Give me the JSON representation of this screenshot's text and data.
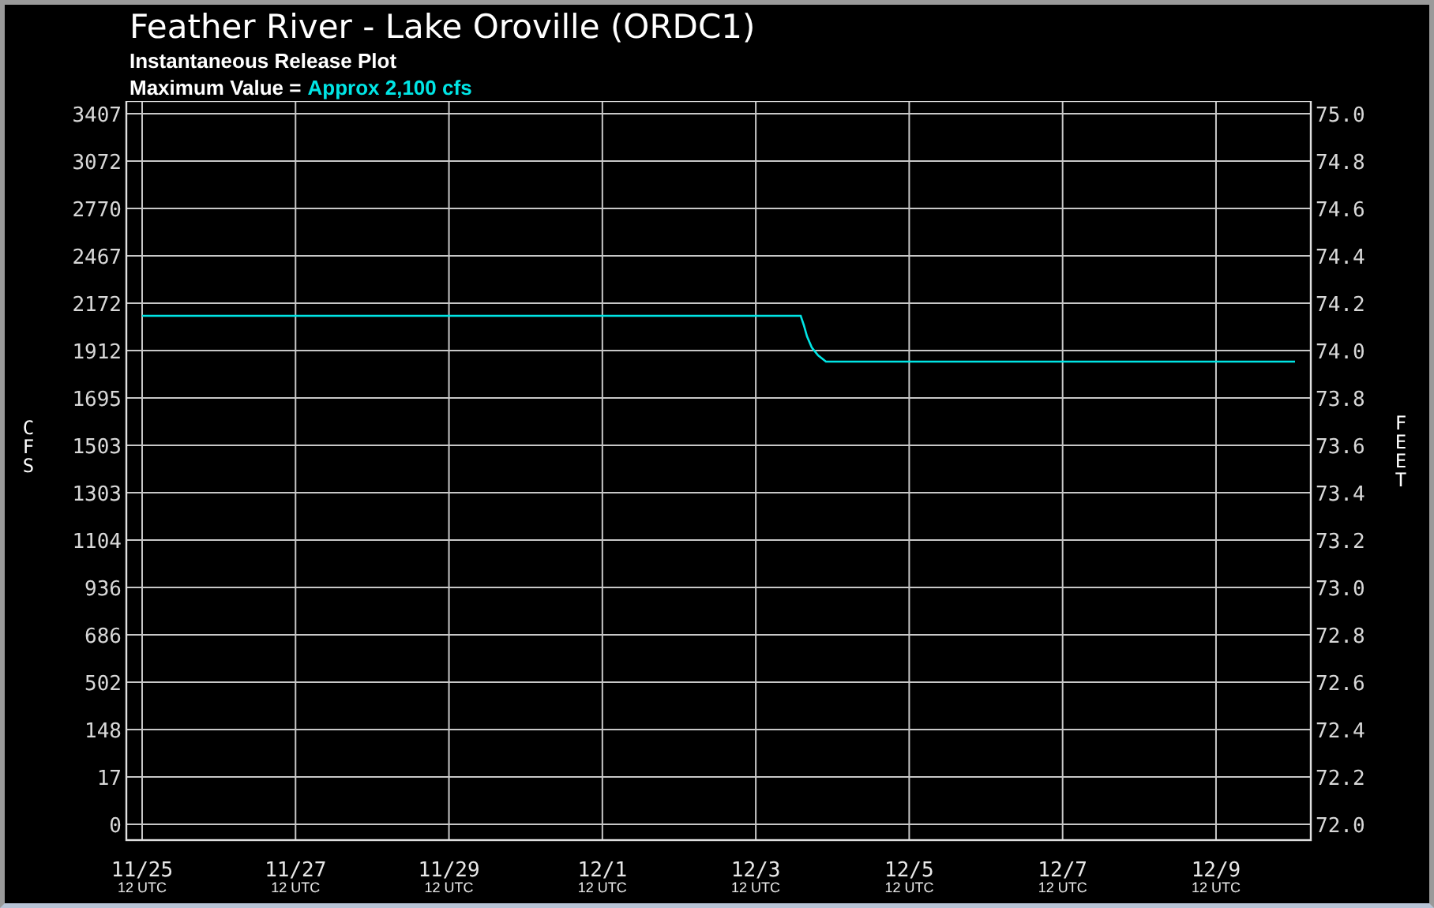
{
  "header": {
    "title": "Feather River - Lake Oroville (ORDC1)",
    "subtitle": "Instantaneous Release Plot",
    "max_label": "Maximum Value =",
    "max_value": "Approx 2,100 cfs"
  },
  "plot": {
    "left_axis": {
      "label": "CFS",
      "ticks": [
        "3407",
        "3072",
        "2770",
        "2467",
        "2172",
        "1912",
        "1695",
        "1503",
        "1303",
        "1104",
        "936",
        "686",
        "502",
        "148",
        "17",
        "0"
      ]
    },
    "right_axis": {
      "label": "FEET",
      "ticks": [
        "75.0",
        "74.8",
        "74.6",
        "74.4",
        "74.2",
        "74.0",
        "73.8",
        "73.6",
        "73.4",
        "73.2",
        "73.0",
        "72.8",
        "72.6",
        "72.4",
        "72.2",
        "72.0"
      ]
    },
    "x_axis": {
      "labels": [
        "11/25",
        "11/27",
        "11/29",
        "12/1",
        "12/3",
        "12/5",
        "12/7",
        "12/9"
      ],
      "sublabels": [
        "12 UTC",
        "12 UTC",
        "12 UTC",
        "12 UTC",
        "12 UTC",
        "12 UTC",
        "12 UTC",
        "12 UTC"
      ]
    }
  }
}
